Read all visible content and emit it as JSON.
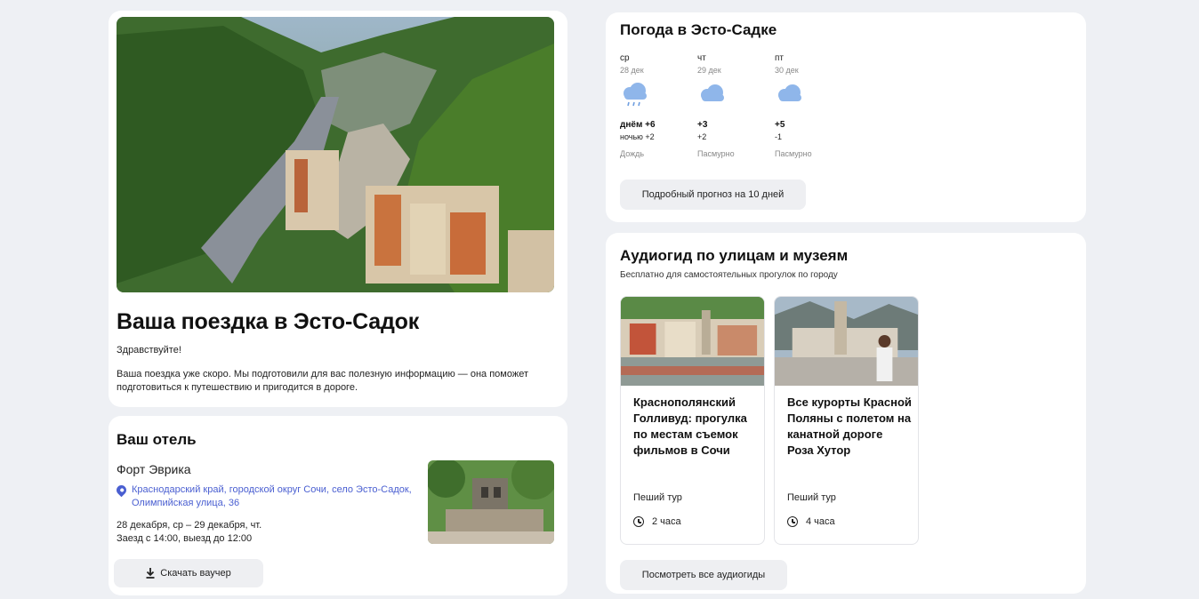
{
  "trip": {
    "title": "Ваша поездка в Эсто-Садок",
    "greeting": "Здравствуйте!",
    "text": "Ваша поездка уже скоро. Мы подготовили для вас полезную информацию — она поможет подготовиться к путешествию и пригодится в дороге."
  },
  "hotel": {
    "heading": "Ваш отель",
    "name": "Форт Эврика",
    "address": "Краснодарский край, городской округ Сочи, село Эсто-Садок, Олимпийская улица, 36",
    "dates": "28 декабря, ср – 29 декабря, чт.",
    "checkin": "Заезд с 14:00, выезд до 12:00",
    "voucher_label": "Скачать ваучер"
  },
  "weather": {
    "title": "Погода в Эсто-Садке",
    "days": [
      {
        "name": "ср",
        "date": "28 дек",
        "icon": "rain-cloud-icon",
        "day_temp": "днём +6",
        "night_temp": "ночью +2",
        "condition": "Дождь"
      },
      {
        "name": "чт",
        "date": "29 дек",
        "icon": "cloud-icon",
        "day_temp": "+3",
        "night_temp": "+2",
        "condition": "Пасмурно"
      },
      {
        "name": "пт",
        "date": "30 дек",
        "icon": "cloud-icon",
        "day_temp": "+5",
        "night_temp": "-1",
        "condition": "Пасмурно"
      }
    ],
    "forecast_button": "Подробный прогноз на 10 дней"
  },
  "audio": {
    "title": "Аудиогид по улицам и музеям",
    "subtitle": "Бесплатно для самостоятельных прогулок по городу",
    "tours": [
      {
        "title": "Краснополянский Голливуд: прогулка по местам съемок фильмов в Сочи",
        "type": "Пеший тур",
        "duration": "2 часа"
      },
      {
        "title": "Все курорты Красной Поляны с полетом на канатной дороге Роза Хутор",
        "type": "Пеший тур",
        "duration": "4 часа"
      }
    ],
    "all_button": "Посмотреть все аудиогиды"
  },
  "colors": {
    "background": "#eef0f4",
    "card": "#ffffff",
    "link": "#4a5fd1",
    "button": "#eeeff2",
    "weather_icon": "#8fb6ea"
  }
}
